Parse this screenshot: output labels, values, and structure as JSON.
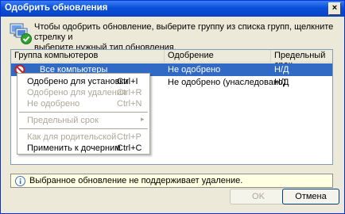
{
  "window": {
    "title": "Одобрить обновления",
    "close_label": "×"
  },
  "header": {
    "line1": "Чтобы одобрить обновление, выберите группу из списка групп, щелкните стрелку и",
    "line2": "выберите нужный тип обновления."
  },
  "list": {
    "columns": [
      "Группа компьютеров",
      "Одобрение",
      "Предельный срок"
    ],
    "rows": [
      {
        "group": "Все компьютеры",
        "approval": "Не одобрено",
        "deadline": "Н/Д",
        "selected": true
      },
      {
        "group": "",
        "approval": "Не одобрено (унаследовано)",
        "deadline": "Н/Д",
        "selected": false
      }
    ]
  },
  "menu": {
    "items": [
      {
        "label": "Одобрено для установки",
        "shortcut": "Ctrl+I",
        "enabled": true
      },
      {
        "label": "Одобрено для удаления",
        "shortcut": "Ctrl+R",
        "enabled": false
      },
      {
        "label": "Не одобрено",
        "shortcut": "Ctrl+N",
        "enabled": false
      },
      {
        "label": "Предельный срок",
        "shortcut": "",
        "enabled": false,
        "submenu_arrow": "▸"
      },
      {
        "label": "Как для родительской",
        "shortcut": "Ctrl+P",
        "enabled": false
      },
      {
        "label": "Применить к дочерним",
        "shortcut": "Ctrl+C",
        "enabled": true
      }
    ]
  },
  "info": {
    "text": "Выбранное обновление не поддерживает удаление."
  },
  "buttons": {
    "ok": "OK",
    "cancel": "Отмена"
  },
  "colors": {
    "selection": "#316ac5",
    "titlebar": "#0a4fd8",
    "face": "#ece9d8"
  }
}
